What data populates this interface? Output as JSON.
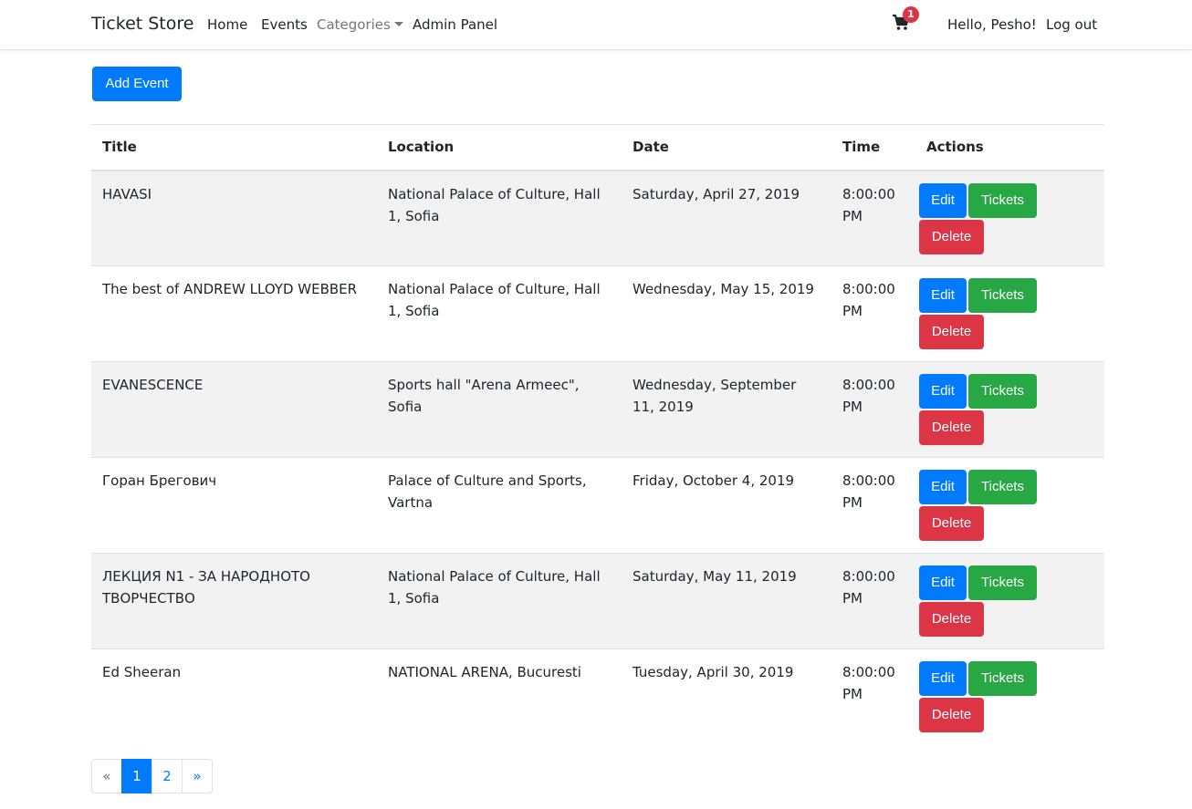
{
  "navbar": {
    "brand": "Ticket Store",
    "links": [
      "Home",
      "Events",
      "Categories",
      "Admin Panel"
    ],
    "cart_count": "1",
    "greeting": "Hello, Pesho!",
    "logout": "Log out"
  },
  "add_event_label": "Add Event",
  "table": {
    "headers": [
      "Title",
      "Location",
      "Date",
      "Time",
      "Actions"
    ],
    "rows": [
      {
        "title": "HAVASI",
        "location": "National Palace of Culture, Hall 1, Sofia",
        "date": "Saturday, April 27, 2019",
        "time": "8:00:00 PM"
      },
      {
        "title": "The best of ANDREW LLOYD WEBBER",
        "location": "National Palace of Culture, Hall 1, Sofia",
        "date": "Wednesday, May 15, 2019",
        "time": "8:00:00 PM"
      },
      {
        "title": "EVANESCENCE",
        "location": "Sports hall \"Arena Armeec\", Sofia",
        "date": "Wednesday, September 11, 2019",
        "time": "8:00:00 PM"
      },
      {
        "title": "Горан Брегович",
        "location": "Palace of Culture and Sports, Vartna",
        "date": "Friday, October 4, 2019",
        "time": "8:00:00 PM"
      },
      {
        "title": "ЛЕКЦИЯ N1 - ЗА НАРОДНОТО ТВОРЧЕСТВО",
        "location": "National Palace of Culture, Hall 1, Sofia",
        "date": "Saturday, May 11, 2019",
        "time": "8:00:00 PM"
      },
      {
        "title": "Ed Sheeran",
        "location": "NATIONAL ARENA, Bucuresti",
        "date": "Tuesday, April 30, 2019",
        "time": "8:00:00 PM"
      }
    ],
    "action_labels": {
      "edit": "Edit",
      "tickets": "Tickets",
      "delete": "Delete"
    }
  },
  "pagination": {
    "prev": "«",
    "pages": [
      "1",
      "2"
    ],
    "active_page": "1",
    "next": "»"
  },
  "colors": {
    "primary": "#007bff",
    "success": "#28a745",
    "danger": "#dc3545",
    "stripe": "#f2f2f2"
  },
  "icons": {
    "cart": "shopping-cart-icon",
    "categories_caret": "caret-down-icon"
  }
}
